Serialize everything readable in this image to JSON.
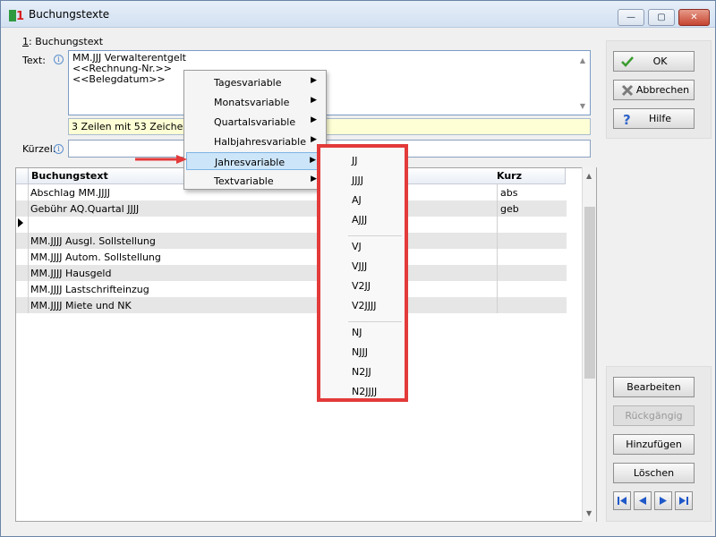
{
  "window": {
    "title": "Buchungstexte",
    "controls": {
      "minimize": "—",
      "maximize": "▢",
      "close": "✕"
    }
  },
  "section": {
    "title": "1: Buchungstext",
    "title_prefix": "1",
    "title_rest": ": Buchungstext"
  },
  "text_field": {
    "label": "Text:",
    "lines": [
      "MM.JJJ Verwalterentgelt",
      "<<Rechnung-Nr.>>",
      "<<Belegdatum>>"
    ],
    "status": "3 Zeilen mit 53 Zeichen"
  },
  "kuerzel_field": {
    "label": "Kürzel:",
    "value": ""
  },
  "buttons": {
    "ok": "OK",
    "cancel": "Abbrechen",
    "help": "Hilfe",
    "edit": "Bearbeiten",
    "undo": "Rückgängig",
    "add": "Hinzufügen",
    "delete": "Löschen"
  },
  "table": {
    "columns": [
      "Buchungstext",
      "Kurz"
    ],
    "rows": [
      {
        "text": "Abschlag MM.JJJJ",
        "kurz": "abs"
      },
      {
        "text": "Gebühr AQ.Quartal JJJJ",
        "kurz": "geb"
      },
      {
        "text": "",
        "kurz": ""
      },
      {
        "text": "MM.JJJJ Ausgl. Sollstellung",
        "kurz": ""
      },
      {
        "text": "MM.JJJJ Autom. Sollstellung",
        "kurz": ""
      },
      {
        "text": "MM.JJJJ Hausgeld",
        "kurz": ""
      },
      {
        "text": "MM.JJJJ Lastschrifteinzug",
        "kurz": ""
      },
      {
        "text": "MM.JJJJ Miete und NK",
        "kurz": ""
      }
    ]
  },
  "context_menu": {
    "items": [
      {
        "label": "Tagesvariable"
      },
      {
        "label": "Monatsvariable"
      },
      {
        "label": "Quartalsvariable"
      },
      {
        "label": "Halbjahresvariable"
      },
      {
        "label": "Jahresvariable",
        "highlighted": true
      },
      {
        "label": "Textvariable"
      }
    ]
  },
  "submenu": {
    "groups": [
      [
        "JJ",
        "JJJJ",
        "AJ",
        "AJJJ"
      ],
      [
        "VJ",
        "VJJJ",
        "V2JJ",
        "V2JJJJ"
      ],
      [
        "NJ",
        "NJJJ",
        "N2JJ",
        "N2JJJJ"
      ]
    ]
  },
  "colors": {
    "highlight": "#cce5f8",
    "callout": "#e33a3a",
    "status_bg": "#ffffd5"
  }
}
